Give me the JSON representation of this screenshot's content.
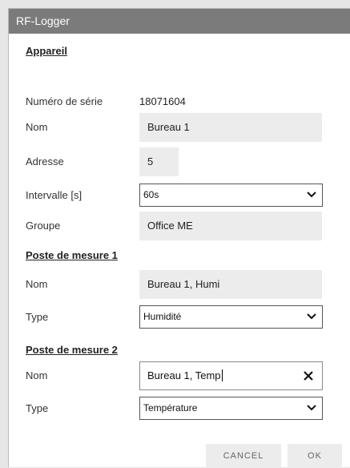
{
  "dialog": {
    "title": "RF-Logger"
  },
  "device": {
    "heading": "Appareil",
    "serial_label": "Numéro de série",
    "serial_value": "18071604",
    "name_label": "Nom",
    "name_value": "Bureau 1",
    "address_label": "Adresse",
    "address_value": "5",
    "interval_label": "Intervalle [s]",
    "interval_value": "60s",
    "group_label": "Groupe",
    "group_value": "Office ME"
  },
  "station1": {
    "heading": "Poste de mesure 1",
    "name_label": "Nom",
    "name_value": "Bureau 1, Humi",
    "type_label": "Type",
    "type_value": "Humidité"
  },
  "station2": {
    "heading": "Poste de mesure 2",
    "name_label": "Nom",
    "name_value": "Bureau 1, Temp",
    "type_label": "Type",
    "type_value": "Température"
  },
  "buttons": {
    "cancel": "CANCEL",
    "ok": "OK"
  },
  "icons": {
    "dropdown": "chevron-down-icon",
    "clear": "close-icon"
  },
  "colors": {
    "titlebar": "#7b7b7b",
    "readonly_field": "#ececec",
    "background": "#e6e6e6"
  }
}
